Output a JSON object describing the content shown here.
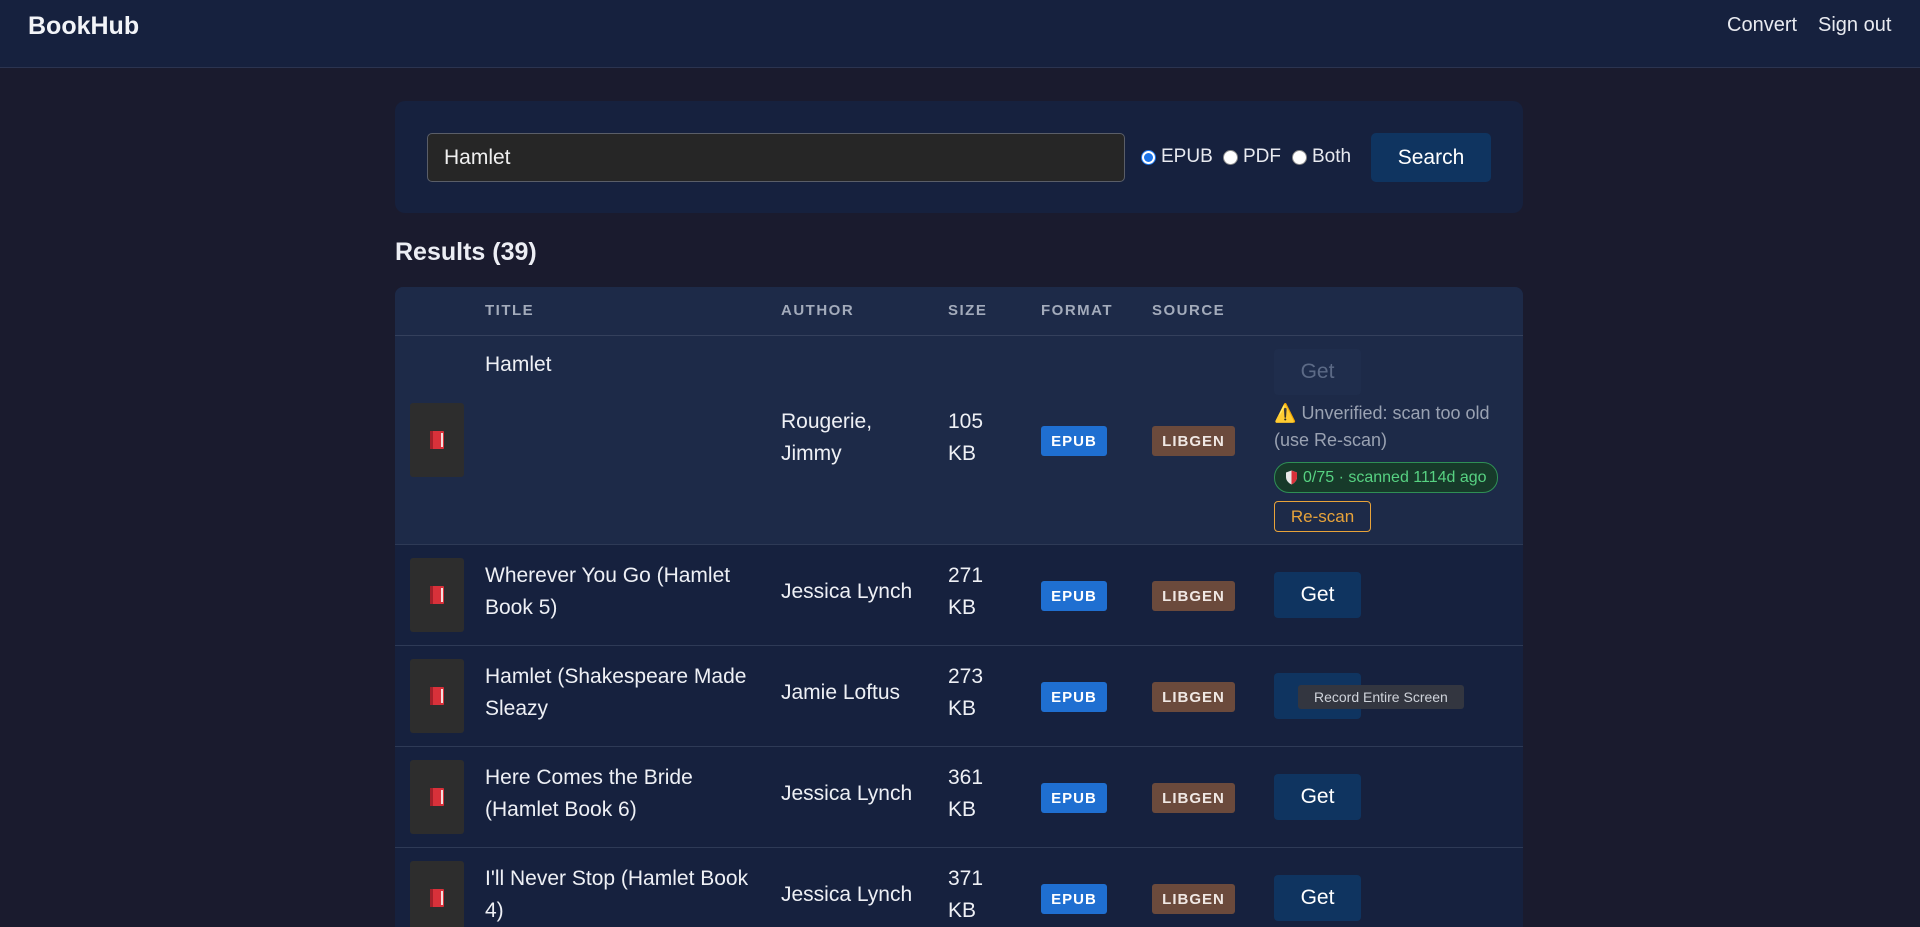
{
  "brand": "BookHub",
  "nav": {
    "convert": "Convert",
    "signout": "Sign out"
  },
  "search": {
    "query": "Hamlet",
    "formats": [
      "EPUB",
      "PDF",
      "Both"
    ],
    "selected_format": "EPUB",
    "button_label": "Search"
  },
  "results": {
    "heading": "Results (39)",
    "columns": [
      "TITLE",
      "AUTHOR",
      "SIZE",
      "FORMAT",
      "SOURCE"
    ],
    "rows": [
      {
        "title": "Hamlet",
        "author": "Rougerie, Jimmy",
        "size": "105 KB",
        "format": "EPUB",
        "source": "LIBGEN",
        "action": "Get",
        "action_disabled": true,
        "warning": "Unverified: scan too old (use Re-scan)",
        "warning_icon": "⚠️",
        "scan_badge": "0/75 · scanned 1114d ago",
        "scan_icon": "shield-icon",
        "rescan_label": "Re-scan"
      },
      {
        "title": "Wherever You Go (Hamlet Book 5)",
        "author": "Jessica Lynch",
        "size": "271 KB",
        "format": "EPUB",
        "source": "LIBGEN",
        "action": "Get"
      },
      {
        "title": "Hamlet (Shakespeare Made Sleazy",
        "author": "Jamie Loftus",
        "size": "273 KB",
        "format": "EPUB",
        "source": "LIBGEN",
        "action": "Get",
        "tooltip": "Record Entire Screen"
      },
      {
        "title": "Here Comes the Bride (Hamlet Book 6)",
        "author": "Jessica Lynch",
        "size": "361 KB",
        "format": "EPUB",
        "source": "LIBGEN",
        "action": "Get"
      },
      {
        "title": "I'll Never Stop (Hamlet Book 4)",
        "author": "Jessica Lynch",
        "size": "371 KB",
        "format": "EPUB",
        "source": "LIBGEN",
        "action": "Get"
      }
    ]
  },
  "icons": {
    "book": "book-icon",
    "warning": "warning-icon"
  },
  "colors": {
    "background": "#1a1b2e",
    "panel": "#16213e",
    "button": "#0f3460",
    "epub_badge": "#1f6fd1",
    "libgen_badge": "#6b4a3c",
    "scan_ok": "#57d282",
    "rescan": "#e8a33a"
  }
}
